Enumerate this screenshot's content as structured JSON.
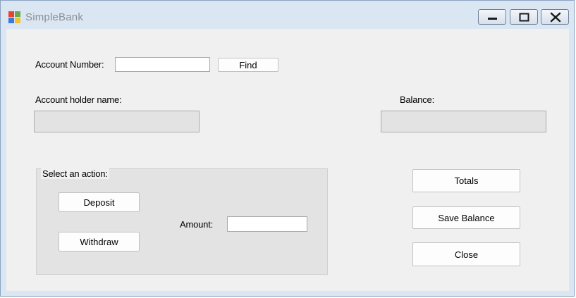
{
  "window": {
    "title": "SimpleBank",
    "icon": "windows-forms-app-icon",
    "controls": [
      "minimize-icon",
      "maximize-icon",
      "close-icon"
    ]
  },
  "form": {
    "account_number_label": "Account Number:",
    "account_number_value": "",
    "find_button": "Find",
    "holder_name_label": "Account holder name:",
    "holder_name_value": "",
    "balance_label": "Balance:",
    "balance_value": ""
  },
  "action_group": {
    "title": "Select an action:",
    "deposit_button": "Deposit",
    "withdraw_button": "Withdraw",
    "amount_label": "Amount:",
    "amount_value": ""
  },
  "side_buttons": {
    "totals": "Totals",
    "save_balance": "Save Balance",
    "close": "Close"
  },
  "colors": {
    "title_bar": "#dbe6f3",
    "client_background": "#f0f0f0",
    "group_background": "#e3e3e3",
    "readonly_field": "#e3e3e3"
  }
}
